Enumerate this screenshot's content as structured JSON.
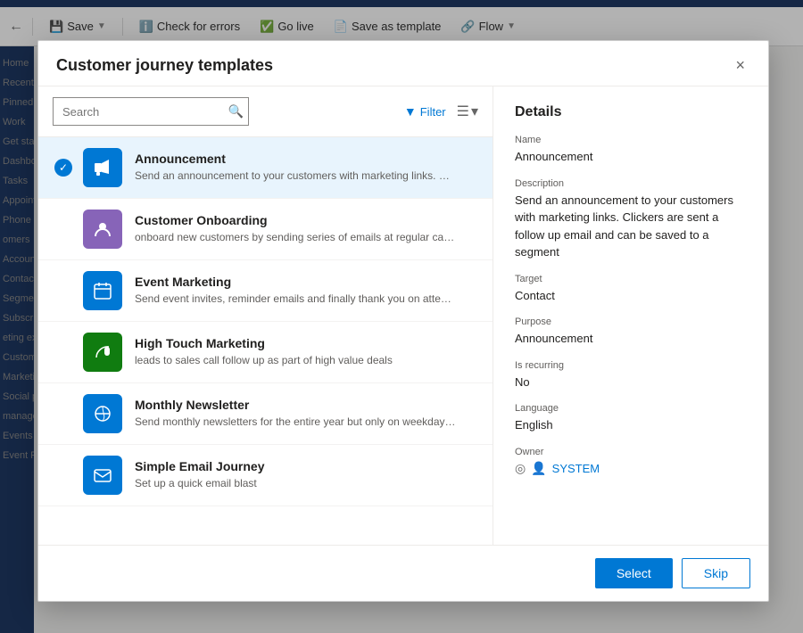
{
  "toolbar": {
    "back_label": "←",
    "save_label": "Save",
    "check_errors_label": "Check for errors",
    "go_live_label": "Go live",
    "save_as_template_label": "Save as template",
    "flow_label": "Flow"
  },
  "modal": {
    "title": "Customer journey templates",
    "close_label": "×",
    "search_placeholder": "Search",
    "filter_label": "Filter",
    "details_title": "Details",
    "select_label": "Select",
    "skip_label": "Skip"
  },
  "templates": [
    {
      "id": "announcement",
      "name": "Announcement",
      "description": "Send an announcement to your customers with marketing links. Clickers are sent a...",
      "icon_color": "#0078d4",
      "icon": "📢",
      "selected": true
    },
    {
      "id": "customer-onboarding",
      "name": "Customer Onboarding",
      "description": "onboard new customers by sending series of emails at regular cadence",
      "icon_color": "#8764b8",
      "icon": "👤",
      "selected": false
    },
    {
      "id": "event-marketing",
      "name": "Event Marketing",
      "description": "Send event invites, reminder emails and finally thank you on attending",
      "icon_color": "#0078d4",
      "icon": "📅",
      "selected": false
    },
    {
      "id": "high-touch-marketing",
      "name": "High Touch Marketing",
      "description": "leads to sales call follow up as part of high value deals",
      "icon_color": "#107c10",
      "icon": "📞",
      "selected": false
    },
    {
      "id": "monthly-newsletter",
      "name": "Monthly Newsletter",
      "description": "Send monthly newsletters for the entire year but only on weekday afternoons",
      "icon_color": "#0078d4",
      "icon": "🔄",
      "selected": false
    },
    {
      "id": "simple-email-journey",
      "name": "Simple Email Journey",
      "description": "Set up a quick email blast",
      "icon_color": "#0078d4",
      "icon": "✉",
      "selected": false
    }
  ],
  "details": {
    "name_label": "Name",
    "name_value": "Announcement",
    "description_label": "Description",
    "description_value": "Send an announcement to your customers with marketing links. Clickers are sent a follow up email and can be saved to a segment",
    "target_label": "Target",
    "target_value": "Contact",
    "purpose_label": "Purpose",
    "purpose_value": "Announcement",
    "recurring_label": "Is recurring",
    "recurring_value": "No",
    "language_label": "Language",
    "language_value": "English",
    "owner_label": "Owner",
    "owner_value": "SYSTEM"
  },
  "bg_nav": {
    "items": [
      "Home",
      "Recent",
      "Pinned",
      "Work",
      "Get start",
      "Dashboa",
      "Tasks",
      "Appoint",
      "Phone C",
      "omers",
      "Account",
      "Contact",
      "Segme",
      "Subscri",
      "eting ex",
      "Custome",
      "Marketi",
      "Social p",
      "manage",
      "Events",
      "Event Re"
    ]
  }
}
